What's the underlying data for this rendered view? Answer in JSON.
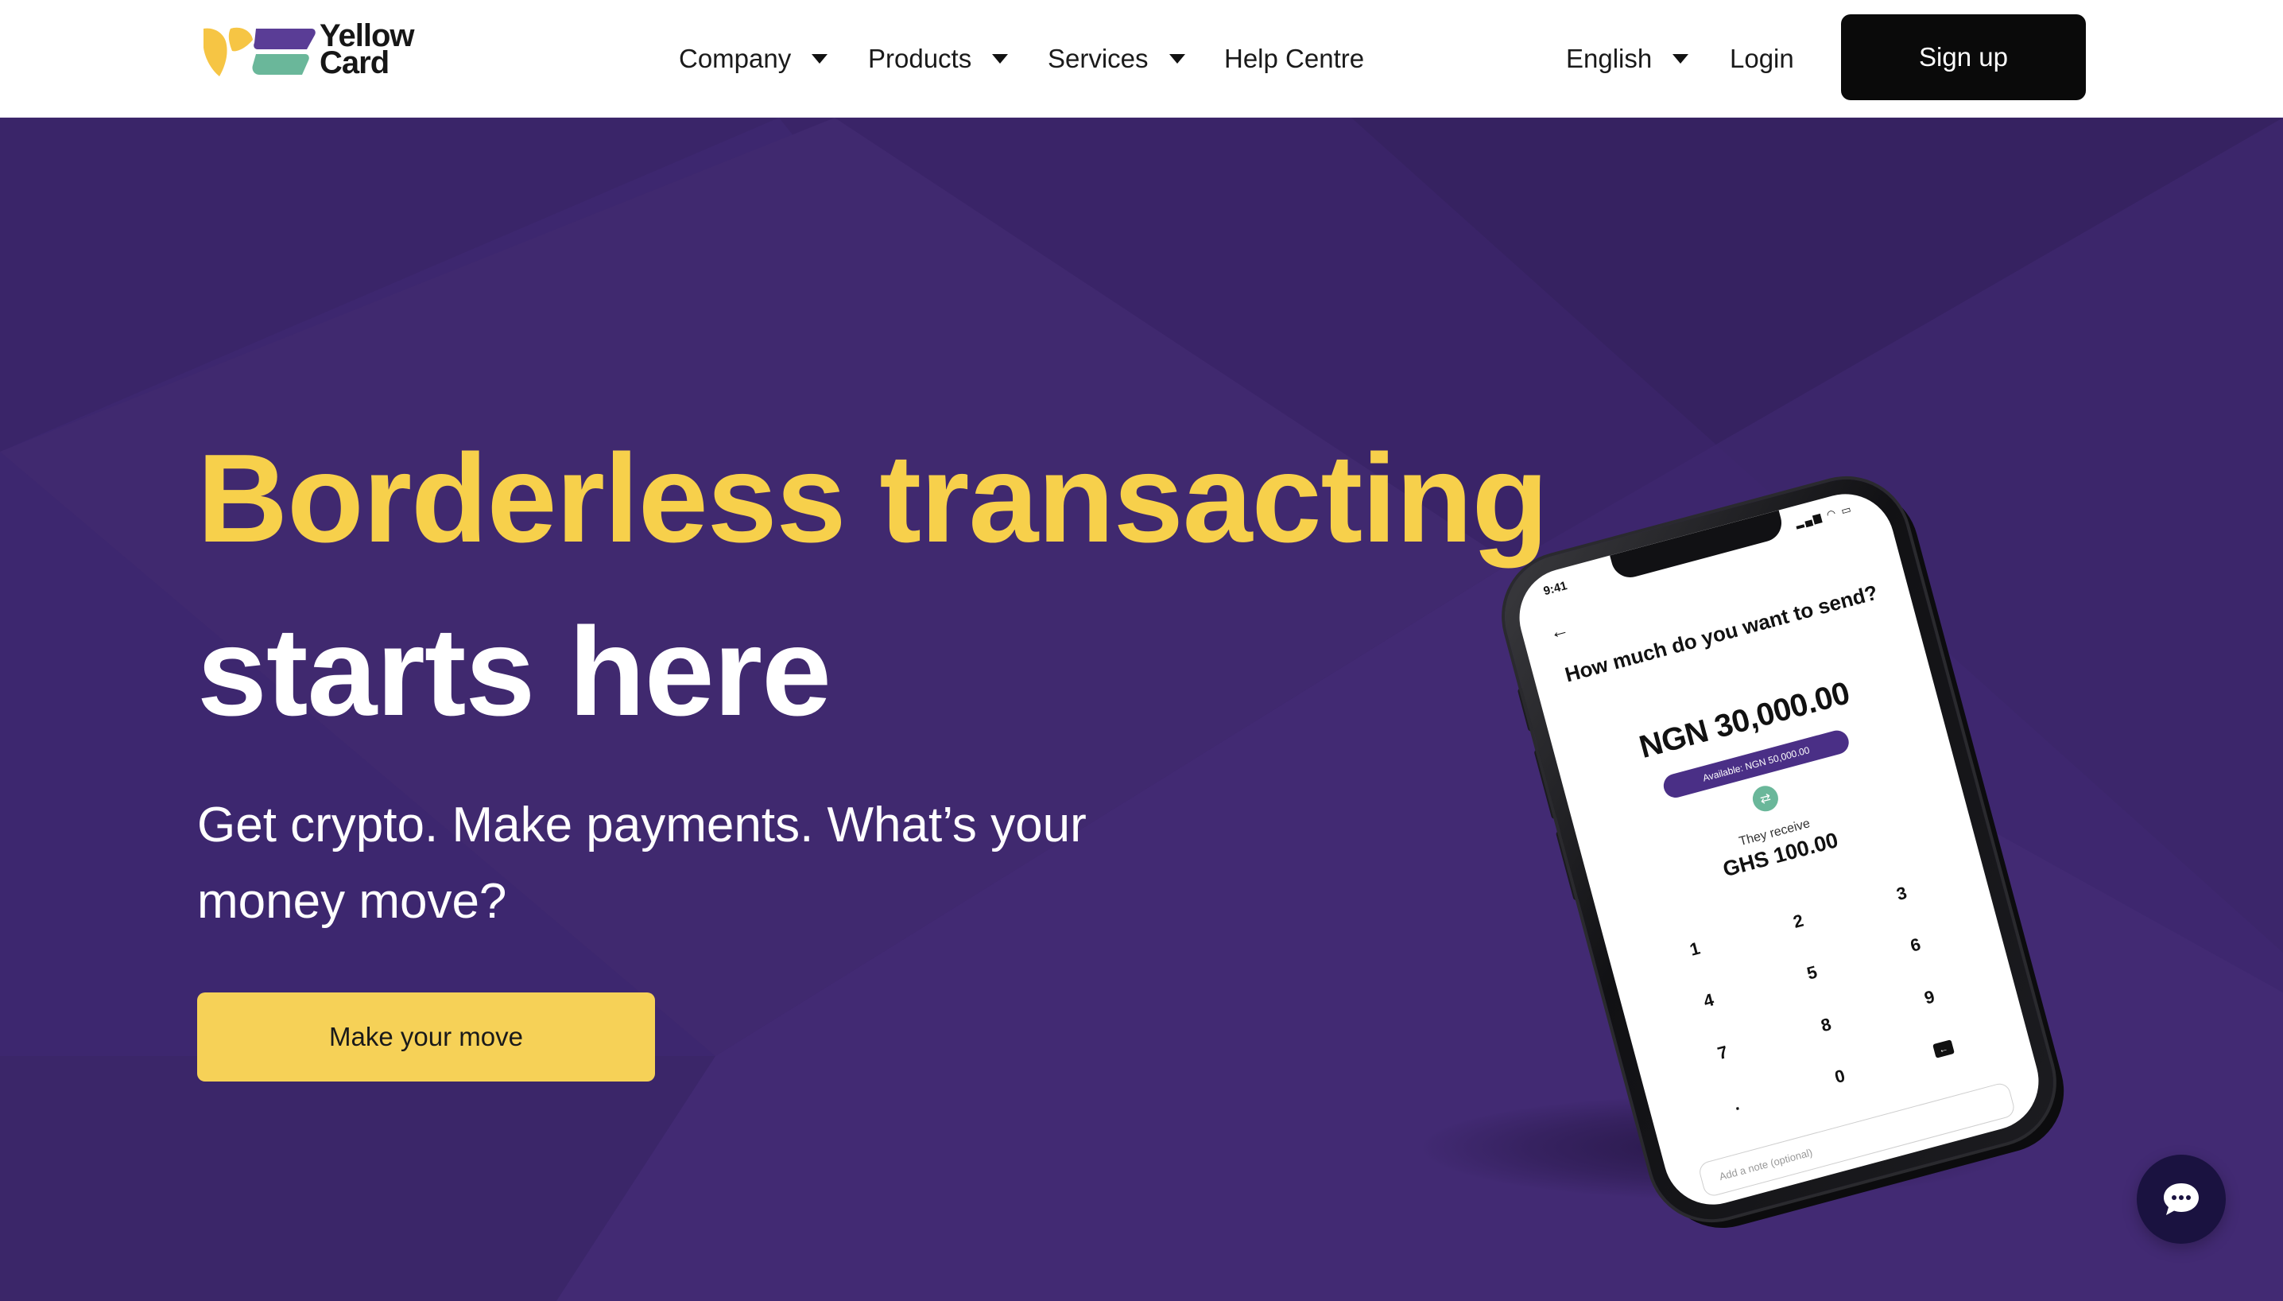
{
  "brand": {
    "name_line1": "Yellow",
    "name_line2": "Card",
    "colors": {
      "yellow": "#f6d157",
      "purple": "#4a2f86",
      "green": "#6ab79a",
      "hero_bg": "#3e2770"
    }
  },
  "nav": {
    "items": [
      {
        "label": "Company",
        "has_dropdown": true
      },
      {
        "label": "Products",
        "has_dropdown": true
      },
      {
        "label": "Services",
        "has_dropdown": true
      },
      {
        "label": "Help Centre",
        "has_dropdown": false
      }
    ],
    "language": "English",
    "login": "Login",
    "signup": "Sign up"
  },
  "hero": {
    "headline_line1": "Borderless transacting",
    "headline_line2": "starts here",
    "subtitle": "Get crypto. Make payments. What’s your money move?",
    "cta": "Make your move"
  },
  "phone": {
    "time": "9:41",
    "question": "How much do you want to send?",
    "amount": "NGN 30,000.00",
    "available": "Available: NGN 50,000.00",
    "receive_label": "They receive",
    "receive_value": "GHS 100.00",
    "keys": [
      "1",
      "2",
      "3",
      "4",
      "5",
      "6",
      "7",
      "8",
      "9",
      ".",
      "0"
    ],
    "note_placeholder": "Add a note (optional)"
  },
  "icons": {
    "caret": "caret-down-icon",
    "chat": "chat-bubble-icon",
    "back": "arrow-left-icon",
    "swap": "swap-icon",
    "backspace": "backspace-icon"
  }
}
